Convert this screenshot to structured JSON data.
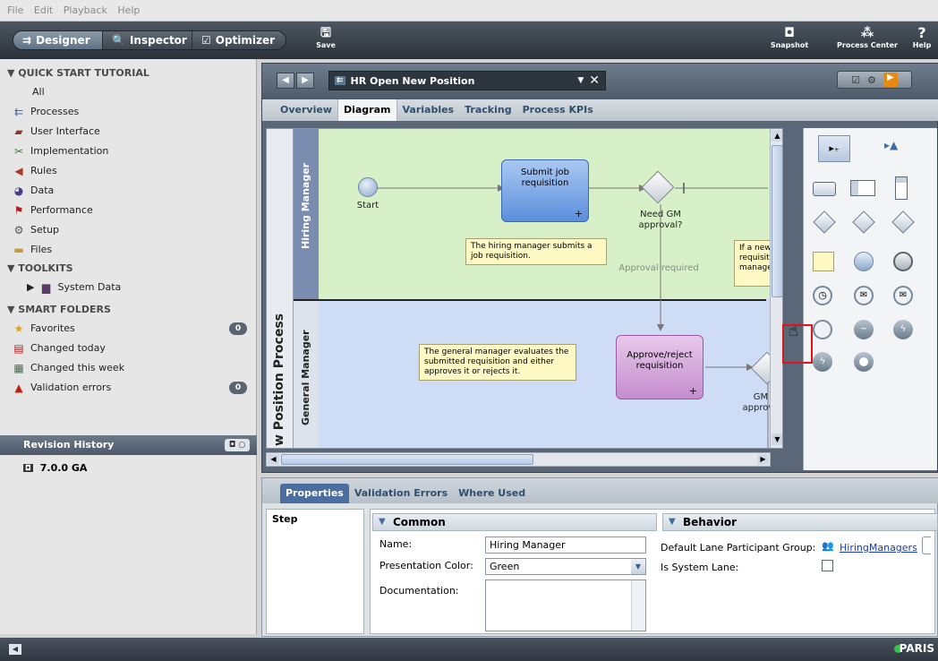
{
  "menubar": {
    "items": [
      "File",
      "Edit",
      "Playback",
      "Help"
    ]
  },
  "toolbar": {
    "modes": [
      "Designer",
      "Inspector",
      "Optimizer"
    ],
    "save": "Save",
    "snapshot": "Snapshot",
    "process_center": "Process Center",
    "help": "Help"
  },
  "sidebar": {
    "quick_start": "QUICK START TUTORIAL",
    "categories": [
      "All",
      "Processes",
      "User Interface",
      "Implementation",
      "Rules",
      "Data",
      "Performance",
      "Setup",
      "Files"
    ],
    "toolkits": "TOOLKITS",
    "system_data": "System Data",
    "smart_folders": "SMART FOLDERS",
    "favorites": "Favorites",
    "favorites_count": "0",
    "changed_today": "Changed today",
    "changed_week": "Changed this week",
    "validation_errors": "Validation errors",
    "validation_count": "0",
    "revision_history": "Revision History",
    "revision": "7.0.0 GA"
  },
  "editor": {
    "process_name": "HR Open New Position",
    "tabs": [
      "Overview",
      "Diagram",
      "Variables",
      "Tracking",
      "Process KPIs"
    ],
    "active_tab": "Diagram"
  },
  "diagram": {
    "pool_label": "w Position Process",
    "lane1": "Hiring Manager",
    "lane2": "General Manager",
    "start": "Start",
    "task1": "Submit job requisition",
    "gateway1": "Need GM approval?",
    "note1": "The hiring manager submits a job requisition.",
    "note2": "If a new requisitio manage",
    "approval_required": "Approval required",
    "note3": "The general manager evaluates the submitted requisition and either approves it or rejects it.",
    "task2": "Approve/reject requisition",
    "gateway2": "GM approve"
  },
  "properties": {
    "tabs": [
      "Properties",
      "Validation Errors",
      "Where Used"
    ],
    "step": "Step",
    "common": "Common",
    "name_label": "Name:",
    "name_value": "Hiring Manager",
    "color_label": "Presentation Color:",
    "color_value": "Green",
    "doc_label": "Documentation:",
    "behavior": "Behavior",
    "group_label": "Default Lane Participant Group:",
    "group_value": "HiringManagers",
    "system_lane_label": "Is System Lane:"
  },
  "status": {
    "server": "PARIS"
  }
}
